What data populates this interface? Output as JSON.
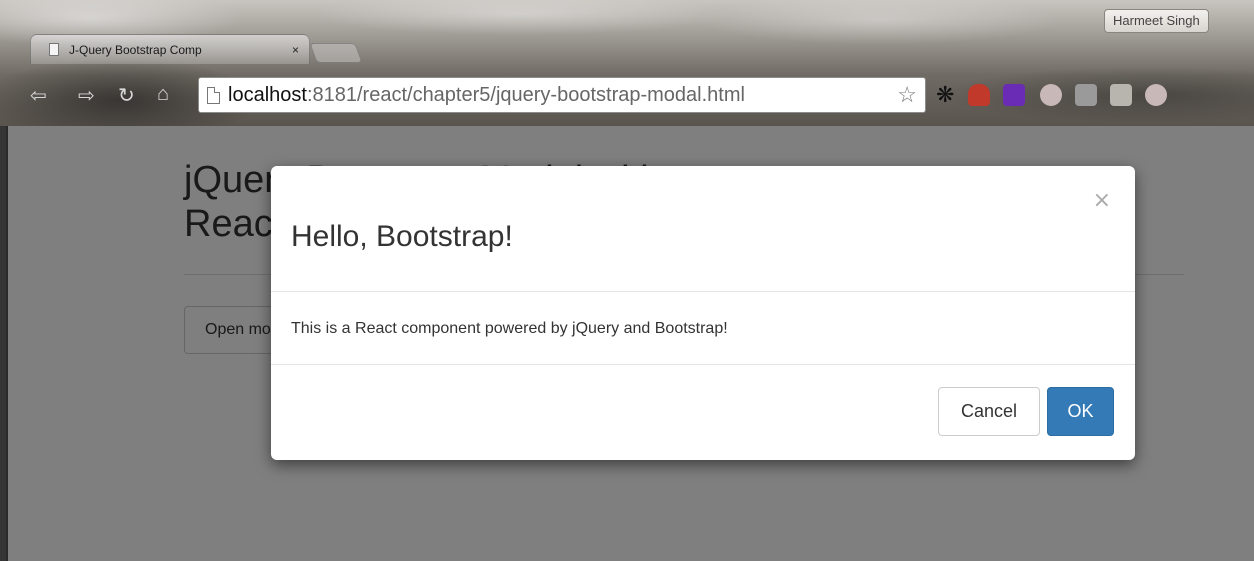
{
  "browser": {
    "user_name": "Harmeet Singh",
    "tab": {
      "title": "J-Query Bootstrap Comp",
      "close_label": "×"
    },
    "nav": {
      "back_icon": "back-arrow-icon",
      "forward_icon": "forward-arrow-icon",
      "reload_icon": "reload-icon",
      "home_icon": "home-icon"
    },
    "address": {
      "host": "localhost",
      "path": ":8181/react/chapter5/jquery-bootstrap-modal.html"
    },
    "extensions": [
      "gear-icon",
      "incognito-icon",
      "extension-purple-icon",
      "angular-icon",
      "extension-square-icon",
      "extension-list-icon",
      "angular-icon"
    ]
  },
  "page": {
    "heading": "jQuery Bootstrap Modal with React",
    "open_button_label": "Open modal"
  },
  "modal": {
    "title": "Hello, Bootstrap!",
    "close_label": "×",
    "body_text": "This is a React component powered by jQuery and Bootstrap!",
    "cancel_label": "Cancel",
    "ok_label": "OK"
  },
  "colors": {
    "primary_button": "#337ab7",
    "backdrop": "rgba(0,0,0,0.5)"
  }
}
